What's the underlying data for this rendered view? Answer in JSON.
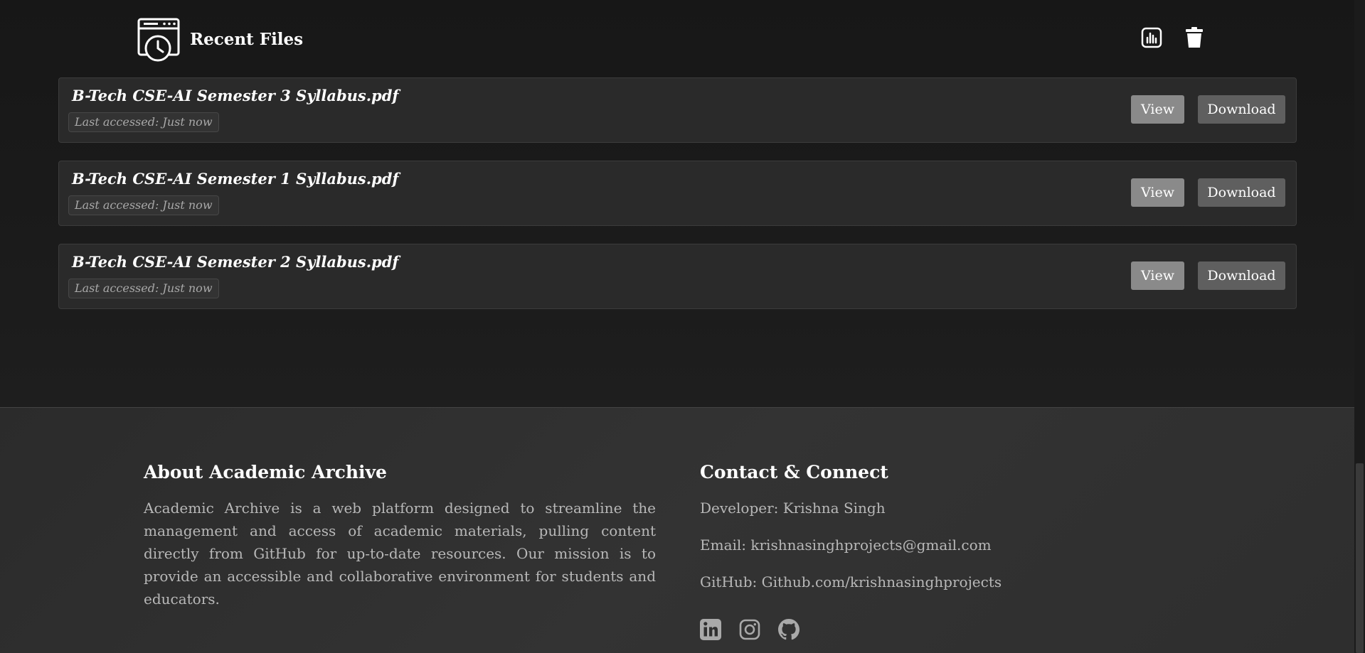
{
  "recent_files": {
    "title": "Recent Files",
    "header_icon": "recent-files-clock-window-icon",
    "actions": [
      {
        "name": "stats-icon",
        "label": ""
      },
      {
        "name": "trash-icon",
        "label": ""
      }
    ],
    "items": [
      {
        "filename": "B-Tech CSE-AI Semester 3 Syllabus.pdf",
        "accessed": "Last accessed: Just now",
        "view_label": "View",
        "download_label": "Download"
      },
      {
        "filename": "B-Tech CSE-AI Semester 1 Syllabus.pdf",
        "accessed": "Last accessed: Just now",
        "view_label": "View",
        "download_label": "Download"
      },
      {
        "filename": "B-Tech CSE-AI Semester 2 Syllabus.pdf",
        "accessed": "Last accessed: Just now",
        "view_label": "View",
        "download_label": "Download"
      }
    ]
  },
  "footer": {
    "about": {
      "heading": "About Academic Archive",
      "text": "Academic Archive is a web platform designed to streamline the management and access of academic materials, pulling content directly from GitHub for up-to-date resources. Our mission is to provide an accessible and collaborative environment for students and educators."
    },
    "contact": {
      "heading": "Contact & Connect",
      "developer": "Developer: Krishna Singh",
      "email": "Email: krishnasinghprojects@gmail.com",
      "github": "GitHub: Github.com/krishnasinghprojects",
      "socials": [
        "linkedin-icon",
        "instagram-icon",
        "github-icon"
      ]
    }
  },
  "colors": {
    "background": "#161616",
    "card": "#2a2a2a",
    "view_button": "#8a8a8a",
    "download_button": "#5f5f5f",
    "footer": "#303030",
    "muted_text": "#b8b8b8"
  }
}
